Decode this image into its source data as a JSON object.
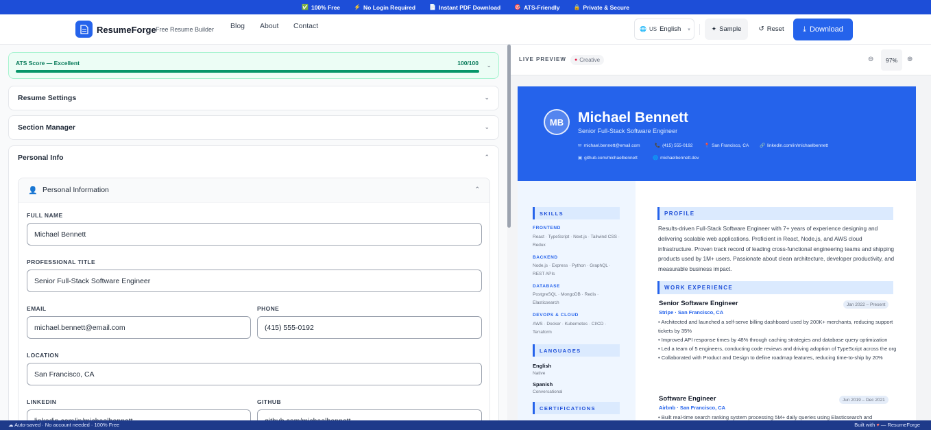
{
  "banner": {
    "items": [
      {
        "icon": "check-icon",
        "glyph": "✅",
        "label": "100% Free"
      },
      {
        "icon": "lightning-icon",
        "glyph": "⚡",
        "label": "No Login Required"
      },
      {
        "icon": "document-icon",
        "glyph": "📄",
        "label": "Instant PDF Download"
      },
      {
        "icon": "target-icon",
        "glyph": "🎯",
        "label": "ATS-Friendly"
      },
      {
        "icon": "lock-icon",
        "glyph": "🔒",
        "label": "Private & Secure"
      }
    ]
  },
  "header": {
    "brand": "ResumeForge",
    "subtitle": "Free Resume Builder",
    "nav": [
      "Blog",
      "About",
      "Contact"
    ],
    "language": {
      "flag": "US",
      "label": "English"
    },
    "sample_label": "Sample",
    "reset_label": "Reset",
    "download_label": "Download"
  },
  "editor": {
    "ats": {
      "label": "ATS Score — Excellent",
      "value": "100/100",
      "progress": 1.0,
      "color": "#059669"
    },
    "sections": [
      {
        "title": "Resume Settings"
      },
      {
        "title": "Section Manager"
      },
      {
        "title": "Personal Info"
      }
    ],
    "personal": {
      "title": "Personal Information",
      "fields": {
        "full_name": {
          "label": "FULL NAME",
          "value": "Michael Bennett"
        },
        "professional_title": {
          "label": "PROFESSIONAL TITLE",
          "value": "Senior Full-Stack Software Engineer"
        },
        "email": {
          "label": "EMAIL",
          "value": "michael.bennett@email.com"
        },
        "phone": {
          "label": "PHONE",
          "value": "(415) 555-0192"
        },
        "location": {
          "label": "LOCATION",
          "value": "San Francisco, CA"
        },
        "linkedin": {
          "label": "LINKEDIN",
          "value": "linkedin.com/in/michaelbennett"
        },
        "github": {
          "label": "GITHUB",
          "value": "github.com/michaelbennett"
        }
      }
    }
  },
  "preview": {
    "label": "LIVE PREVIEW",
    "template": "Creative",
    "zoom": "97%",
    "resume": {
      "initials": "MB",
      "name": "Michael Bennett",
      "title": "Senior Full-Stack Software Engineer",
      "contacts": [
        {
          "icon": "email-icon",
          "glyph": "✉",
          "text": "michael.bennett@email.com"
        },
        {
          "icon": "phone-icon",
          "glyph": "📞",
          "text": "(415) 555-0192"
        },
        {
          "icon": "pin-icon",
          "glyph": "📍",
          "text": "San Francisco, CA"
        },
        {
          "icon": "link-icon",
          "glyph": "🔗",
          "text": "linkedin.com/in/michaelbennett"
        },
        {
          "icon": "github-icon",
          "glyph": "▣",
          "text": "github.com/michaelbennett"
        },
        {
          "icon": "globe-icon",
          "glyph": "🌐",
          "text": "michaelbennett.dev"
        }
      ],
      "skills_heading": "SKILLS",
      "skill_groups": [
        {
          "category": "FRONTEND",
          "items": "React · TypeScript · Next.js · Tailwind CSS · Redux"
        },
        {
          "category": "BACKEND",
          "items": "Node.js · Express · Python · GraphQL · REST APIs"
        },
        {
          "category": "DATABASE",
          "items": "PostgreSQL · MongoDB · Redis · Elasticsearch"
        },
        {
          "category": "DEVOPS & CLOUD",
          "items": "AWS · Docker · Kubernetes · CI/CD · Terraform"
        }
      ],
      "languages_heading": "LANGUAGES",
      "languages": [
        {
          "name": "English",
          "level": "Native"
        },
        {
          "name": "Spanish",
          "level": "Conversational"
        }
      ],
      "certifications_heading": "CERTIFICATIONS",
      "profile_heading": "PROFILE",
      "profile": "Results-driven Full-Stack Software Engineer with 7+ years of experience designing and delivering scalable web applications. Proficient in React, Node.js, and AWS cloud infrastructure. Proven track record of leading cross-functional engineering teams and shipping products used by 1M+ users. Passionate about clean architecture, developer productivity, and measurable business impact.",
      "experience_heading": "WORK EXPERIENCE",
      "jobs": [
        {
          "title": "Senior Software Engineer",
          "company": "Stripe · San Francisco, CA",
          "dates": "Jan 2022 – Present",
          "bullets": [
            "• Architected and launched a self-serve billing dashboard used by 200K+ merchants, reducing support tickets by 35%",
            "• Improved API response times by 48% through caching strategies and database query optimization",
            "• Led a team of 5 engineers, conducting code reviews and driving adoption of TypeScript across the org",
            "• Collaborated with Product and Design to define roadmap features, reducing time-to-ship by 20%"
          ]
        },
        {
          "title": "Software Engineer",
          "company": "Airbnb · San Francisco, CA",
          "dates": "Jun 2019 – Dec 2021",
          "bullets": [
            "• Built real-time search ranking system processing 5M+ daily queries using Elasticsearch and"
          ]
        }
      ]
    }
  },
  "footer": {
    "left": "☁ Auto-saved · No account needed · 100% Free",
    "right_prefix": "Built with",
    "heart": "♥",
    "right_suffix": "— ResumeForge"
  },
  "colors": {
    "brand": "#2563eb",
    "banner": "#1d4ed8",
    "ats_green": "#059669",
    "footer": "#1e3a8a"
  }
}
